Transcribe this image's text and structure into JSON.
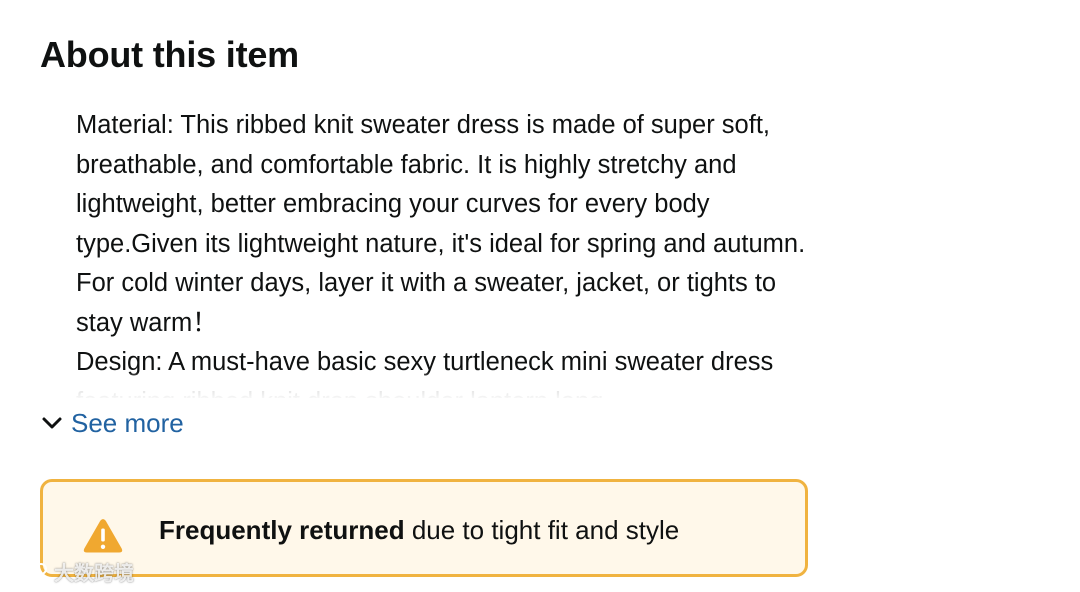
{
  "section": {
    "title": "About this item"
  },
  "bullets": [
    "Material: This ribbed knit sweater dress is made of super soft, breathable, and comfortable fabric. It is highly stretchy and lightweight, better embracing your curves for every body type.Given its lightweight nature, it's ideal for spring and autumn. For cold winter days, layer it with a sweater, jacket, or tights to stay warm！",
    "Design: A must-have basic sexy turtleneck mini sweater dress featuring ribbed knit drop shoulder lantern long"
  ],
  "see_more": {
    "label": "See more",
    "icon": "chevron-down-icon"
  },
  "alert": {
    "bold_text": "Frequently returned",
    "rest_text": " due to tight fit and style",
    "icon": "warning-icon",
    "colors": {
      "border": "#f0b340",
      "background": "#fff8ea",
      "icon": "#f0a830"
    }
  },
  "watermark": {
    "text": "大数跨境"
  },
  "colors": {
    "link": "#2162a1",
    "text": "#0f1111"
  }
}
